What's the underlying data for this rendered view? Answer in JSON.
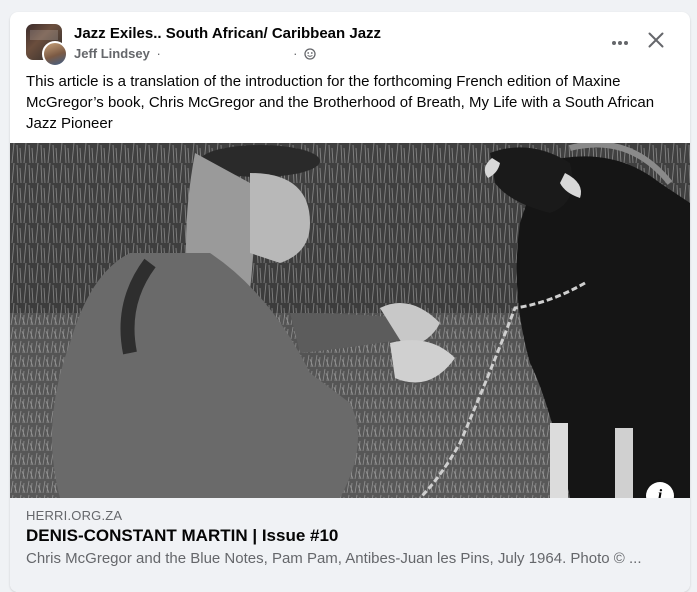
{
  "post": {
    "group_name": "Jazz Exiles.. South African/ Caribbean Jazz",
    "author": "Jeff Lindsey",
    "meta_separator": "·",
    "privacy_icon": "public-globe-icon",
    "text": "This article is a translation of the introduction for the forthcoming French edition of Maxine McGregor’s book, Chris McGregor and the Brotherhood of Breath, My Life with a South African Jazz Pioneer"
  },
  "actions": {
    "more_icon": "more-horizontal-icon",
    "close_icon": "close-icon",
    "info_icon": "info-icon",
    "info_glyph": "i"
  },
  "link_preview": {
    "domain": "HERRI.ORG.ZA",
    "title": "DENIS-CONSTANT MARTIN | Issue #10",
    "description": "Chris McGregor and the Blue Notes, Pam Pam, Antibes-Juan les Pins, July 1964. Photo © ..."
  },
  "colors": {
    "card_bg": "#ffffff",
    "page_bg": "#f0f2f5",
    "primary_text": "#050505",
    "secondary_text": "#65676b",
    "link_preview_bg": "#f0f2f5"
  }
}
